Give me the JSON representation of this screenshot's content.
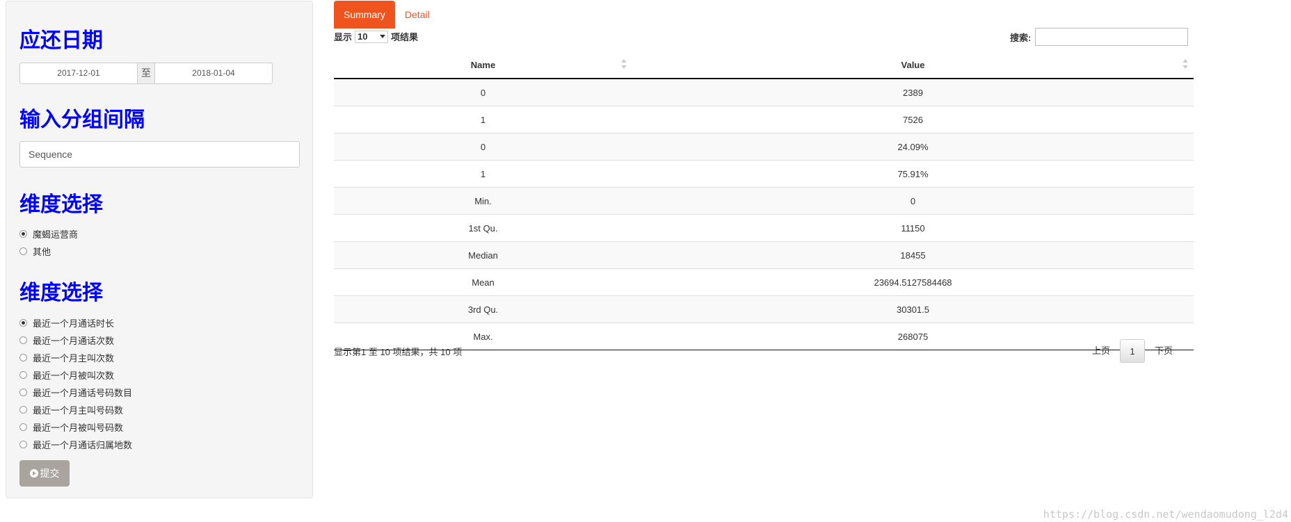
{
  "sidebar": {
    "date_heading": "应还日期",
    "date_start": "2017-12-01",
    "date_sep": "至",
    "date_end": "2018-01-04",
    "interval_heading": "输入分组间隔",
    "interval_value": "Sequence",
    "dim1_heading": "维度选择",
    "dim1_options": [
      "魔蝎运营商",
      "其他"
    ],
    "dim2_heading": "维度选择",
    "dim2_options": [
      "最近一个月通话时长",
      "最近一个月通话次数",
      "最近一个月主叫次数",
      "最近一个月被叫次数",
      "最近一个月通话号码数目",
      "最近一个月主叫号码数",
      "最近一个月被叫号码数",
      "最近一个月通话归属地数"
    ],
    "submit_label": "提交"
  },
  "tabs": [
    "Summary",
    "Detail"
  ],
  "table_controls": {
    "length_prefix": "显示",
    "length_value": "10",
    "length_suffix": "项结果",
    "search_label": "搜索:"
  },
  "table": {
    "headers": [
      "Name",
      "Value"
    ],
    "rows": [
      [
        "0",
        "2389"
      ],
      [
        "1",
        "7526"
      ],
      [
        "0",
        "24.09%"
      ],
      [
        "1",
        "75.91%"
      ],
      [
        "Min.",
        "0"
      ],
      [
        "1st Qu.",
        "11150"
      ],
      [
        "Median",
        "18455"
      ],
      [
        "Mean",
        "23694.5127584468"
      ],
      [
        "3rd Qu.",
        "30301.5"
      ],
      [
        "Max.",
        "268075"
      ]
    ]
  },
  "footer": {
    "info": "显示第1 至 10 项结果，共 10 项",
    "prev": "上页",
    "current_page": "1",
    "next": "下页"
  },
  "watermark": "https://blog.csdn.net/wendaomudong_l2d4",
  "colors": {
    "heading": "#0000ff",
    "tab_active": "#f0541e",
    "submit_bg": "#aaa49e"
  }
}
